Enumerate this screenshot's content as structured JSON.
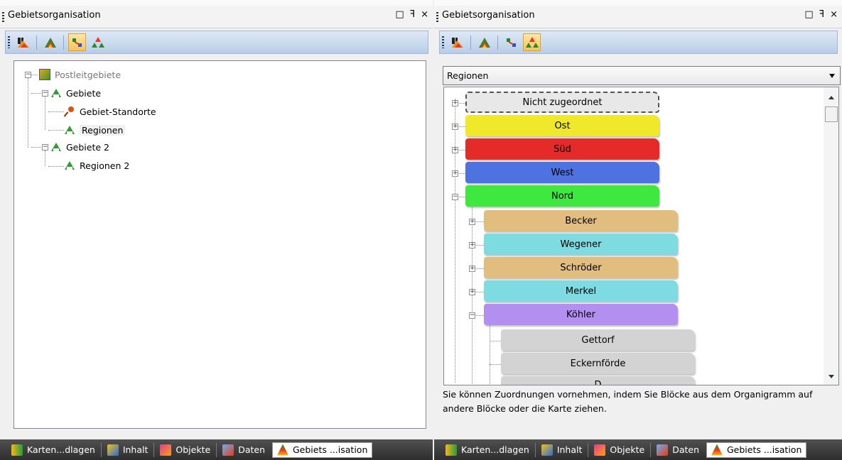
{
  "left": {
    "title": "Gebietsorganisation",
    "controls": [
      "□",
      "ꟻ",
      "×"
    ],
    "tree": {
      "root": "Postleitgebiete",
      "items": [
        {
          "label": "Gebiete"
        },
        {
          "label": "Gebiet-Standorte"
        },
        {
          "label": "Regionen"
        },
        {
          "label": "Gebiete 2"
        },
        {
          "label": "Regionen 2"
        }
      ]
    }
  },
  "right": {
    "title": "Gebietsorganisation",
    "controls": [
      "□",
      "ꟻ",
      "×"
    ],
    "selector": "Regionen",
    "blocks": [
      {
        "label": "Nicht zugeordnet",
        "color": "#e8e8e8"
      },
      {
        "label": "Ost",
        "color": "#f0e82a"
      },
      {
        "label": "Süd",
        "color": "#e52a2a"
      },
      {
        "label": "West",
        "color": "#4e72e0"
      },
      {
        "label": "Nord",
        "color": "#3ee83e"
      },
      {
        "label": "Becker",
        "color": "#e2bd80"
      },
      {
        "label": "Wegener",
        "color": "#7fdbe2"
      },
      {
        "label": "Schröder",
        "color": "#e2bd80"
      },
      {
        "label": "Merkel",
        "color": "#7fdbe2"
      },
      {
        "label": "Köhler",
        "color": "#b38ff0"
      },
      {
        "label": "Gettorf",
        "color": "#d3d3d3"
      },
      {
        "label": "Eckernförde",
        "color": "#d3d3d3"
      },
      {
        "label": "D",
        "color": "#d3d3d3"
      }
    ],
    "hint": "Sie können Zuordnungen vornehmen, indem Sie Blöcke aus dem Organigramm auf andere Blöcke oder die Karte ziehen."
  },
  "tabs": [
    "Karten...dlagen",
    "Inhalt",
    "Objekte",
    "Daten",
    "Gebiets ...isation"
  ],
  "colors": {
    "toolbar": "#c8d9ef",
    "tabbar": "#3c3c3c",
    "active_toolbar_btn": "#f9c25a"
  }
}
